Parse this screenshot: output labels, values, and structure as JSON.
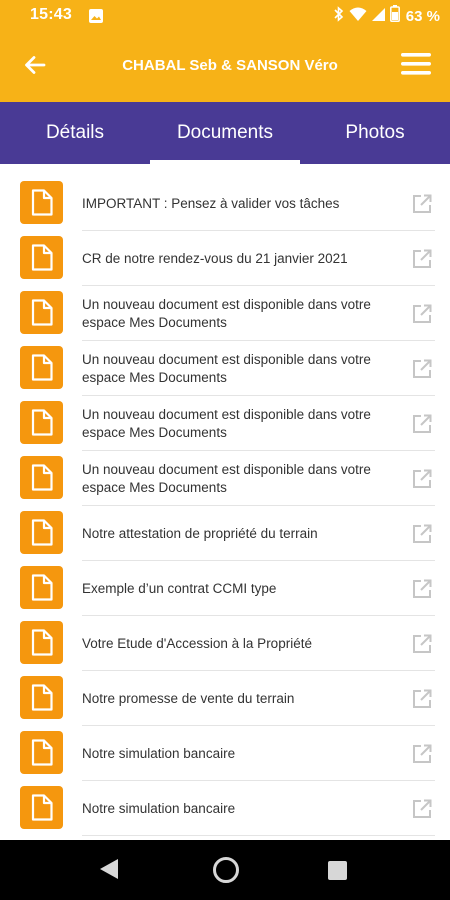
{
  "status_bar": {
    "time": "15:43",
    "battery_percent": "63 %",
    "icons": [
      "image-icon",
      "bluetooth-icon",
      "wifi-icon",
      "signal-icon",
      "battery-icon"
    ]
  },
  "app_bar": {
    "title": "CHABAL Seb & SANSON Véro",
    "background_color": "#F7B217",
    "icons": [
      "back-arrow-icon",
      "hamburger-menu-icon"
    ]
  },
  "tabs": {
    "background_color": "#493A95",
    "selected": "Documents",
    "items": [
      {
        "label": "Détails"
      },
      {
        "label": "Documents"
      },
      {
        "label": "Photos"
      }
    ]
  },
  "documents": {
    "icon_color": "#F5970E",
    "item_icons": [
      "file-icon",
      "open-external-icon"
    ],
    "items": [
      {
        "title": "IMPORTANT : Pensez à valider vos tâches"
      },
      {
        "title": "CR de notre rendez-vous du 21 janvier 2021"
      },
      {
        "title": "Un nouveau document est disponible dans votre espace Mes Documents"
      },
      {
        "title": "Un nouveau document est disponible dans votre espace Mes Documents"
      },
      {
        "title": "Un nouveau document est disponible dans votre espace Mes Documents"
      },
      {
        "title": "Un nouveau document est disponible dans votre espace Mes Documents"
      },
      {
        "title": "Notre attestation de propriété du terrain"
      },
      {
        "title": "Exemple d’un contrat CCMI type"
      },
      {
        "title": "Votre Etude d'Accession à la Propriété"
      },
      {
        "title": "Notre promesse de vente du terrain"
      },
      {
        "title": "Notre simulation bancaire"
      },
      {
        "title": "Notre simulation bancaire"
      }
    ]
  },
  "nav_bar": {
    "icons": [
      "nav-back-icon",
      "nav-home-icon",
      "nav-recents-icon"
    ]
  }
}
